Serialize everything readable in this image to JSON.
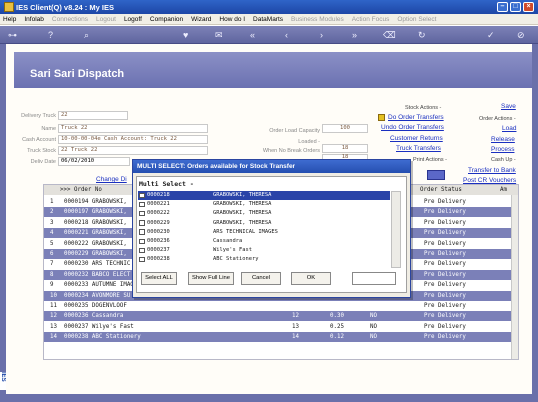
{
  "window": {
    "title": "IES Client(Q) v8.24 : My IES"
  },
  "menu": [
    {
      "label": "Help",
      "enabled": true
    },
    {
      "label": "Infolab",
      "enabled": true
    },
    {
      "label": "Connections",
      "enabled": false
    },
    {
      "label": "Logout",
      "enabled": false
    },
    {
      "label": "Logoff",
      "enabled": true
    },
    {
      "label": "Companion",
      "enabled": true
    },
    {
      "label": "Wizard",
      "enabled": true
    },
    {
      "label": "How do I",
      "enabled": true
    },
    {
      "label": "DataMarts",
      "enabled": true
    },
    {
      "label": "Business Modules",
      "enabled": false
    },
    {
      "label": "Action Focus",
      "enabled": false
    },
    {
      "label": "Option Select",
      "enabled": false
    }
  ],
  "toolbar_icons": [
    "key-icon",
    "help-icon",
    "search-icon",
    "heart-icon",
    "mail-icon",
    "rewind-icon",
    "back-icon",
    "forward-icon",
    "fast-forward-icon",
    "trash-icon",
    "refresh-icon",
    "check-icon",
    "cancel-icon"
  ],
  "screen_title": "Sari Sari Dispatch",
  "form": {
    "delivery_truck_label": "Delivery Truck",
    "delivery_truck": "22",
    "name_label": "Name",
    "name": "Truck 22",
    "cash_account_label": "Cash Account",
    "cash_account": "10-00-00-04e Cash Account: Truck 22",
    "truck_stock_label": "Truck Stock",
    "truck_stock": "22 Truck 22",
    "deliv_date_label": "Deliv Date",
    "deliv_date": "06/02/2010",
    "change_link": "Change Di",
    "order_load_capacity_label": "Order Load Capacity",
    "order_load_capacity": "100",
    "loaded_label": "Loaded -",
    "when_no_break_label": "When No Break Orders",
    "when_no_break": "18",
    "hidden_num": "18"
  },
  "actions": {
    "stock_actions_label": "Stock Actions -",
    "do_order_transfers": "Do Order Transfers",
    "undo_order_transfers": "Undo Order Transfers",
    "customer_returns": "Customer Returns",
    "truck_transfers": "Truck Transfers",
    "print_actions_label": "Print Actions -",
    "save": "Save",
    "order_actions_label": "Order Actions -",
    "load": "Load",
    "release": "Release",
    "process": "Process",
    "cash_up_label": "Cash Up -",
    "transfer_to_bank": "Transfer to Bank",
    "post_cr_vouchers": "Post CR Vouchers"
  },
  "grid": {
    "headers": [
      ">>> Order No",
      "Order Status",
      "Am"
    ],
    "rows": [
      {
        "n": "1",
        "order": "0000194 GRABOWSKI,",
        "qty": "",
        "val": "",
        "flag": "",
        "status": "Pre Delivery",
        "hl": false
      },
      {
        "n": "2",
        "order": "0000197 GRABOWSKI,",
        "qty": "",
        "val": "",
        "flag": "",
        "status": "Pre Delivery",
        "hl": true
      },
      {
        "n": "3",
        "order": "0000218 GRABOWSKI,",
        "qty": "",
        "val": "",
        "flag": "",
        "status": "Pre Delivery",
        "hl": false
      },
      {
        "n": "4",
        "order": "0000221 GRABOWSKI,",
        "qty": "",
        "val": "",
        "flag": "",
        "status": "Pre Delivery",
        "hl": true
      },
      {
        "n": "5",
        "order": "0000222 GRABOWSKI,",
        "qty": "",
        "val": "",
        "flag": "",
        "status": "Pre Delivery",
        "hl": false
      },
      {
        "n": "6",
        "order": "0000229 GRABOWSKI,",
        "qty": "",
        "val": "",
        "flag": "",
        "status": "Pre Delivery",
        "hl": true
      },
      {
        "n": "7",
        "order": "0000230 ARS TECHNIC",
        "qty": "",
        "val": "",
        "flag": "",
        "status": "Pre Delivery",
        "hl": false
      },
      {
        "n": "8",
        "order": "0000232 BABCO ELECT",
        "qty": "",
        "val": "",
        "flag": "",
        "status": "Pre Delivery",
        "hl": true
      },
      {
        "n": "9",
        "order": "0000233 AUTUMNE IMAG",
        "qty": "",
        "val": "",
        "flag": "",
        "status": "Pre Delivery",
        "hl": false
      },
      {
        "n": "10",
        "order": "0000234 AVONMORE SU",
        "qty": "",
        "val": "",
        "flag": "",
        "status": "Pre Delivery",
        "hl": true
      },
      {
        "n": "11",
        "order": "0000235 DOGENVLOOF",
        "qty": "",
        "val": "",
        "flag": "",
        "status": "Pre Delivery",
        "hl": false
      },
      {
        "n": "12",
        "order": "0000236 Cassandra",
        "qty": "12",
        "val": "0.30",
        "flag": "NO",
        "status": "Pre Delivery",
        "hl": true
      },
      {
        "n": "13",
        "order": "0000237 Wilye's Fast",
        "qty": "13",
        "val": "0.25",
        "flag": "NO",
        "status": "Pre Delivery",
        "hl": false
      },
      {
        "n": "14",
        "order": "0000238 ABC Stationery",
        "qty": "14",
        "val": "0.12",
        "flag": "NO",
        "status": "Pre Delivery",
        "hl": true
      }
    ]
  },
  "modal": {
    "title": "MULTI SELECT: Orders available for Stock Transfer",
    "heading": "Multi Select -",
    "items": [
      {
        "code": "0000218",
        "name": "GRABOWSKI, THERESA",
        "selected": true
      },
      {
        "code": "0000221",
        "name": "GRABOWSKI, THERESA",
        "selected": false
      },
      {
        "code": "0000222",
        "name": "GRABOWSKI, THERESA",
        "selected": false
      },
      {
        "code": "0000229",
        "name": "GRABOWSKI, THERESA",
        "selected": false
      },
      {
        "code": "0000230",
        "name": "ARS TECHNICAL IMAGES",
        "selected": false
      },
      {
        "code": "0000236",
        "name": "Cassandra",
        "selected": false
      },
      {
        "code": "0000237",
        "name": "Wilye's Fast",
        "selected": false
      },
      {
        "code": "0000238",
        "name": "ABC Stationery",
        "selected": false
      }
    ],
    "buttons": {
      "select_all": "Select ALL",
      "show_full_line": "Show Full Line",
      "cancel": "Cancel",
      "ok": "OK"
    }
  },
  "side_mark": "IES"
}
